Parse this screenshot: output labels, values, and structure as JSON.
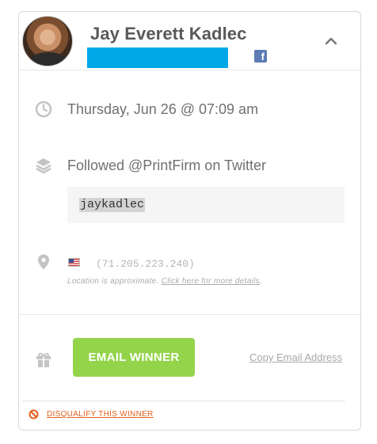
{
  "winner": {
    "name": "Jay Everett Kadlec"
  },
  "entry": {
    "datetime": "Thursday, Jun 26 @ 07:09 am",
    "action": "Followed @PrintFirm on Twitter",
    "handle": "jaykadlec"
  },
  "location": {
    "ip": "(71.205.223.240)",
    "note": "Location is approximate. ",
    "details_link": "Click here for more details",
    "note_end": "."
  },
  "actions": {
    "email_winner_label": "EMAIL WINNER",
    "copy_email_label": "Copy Email Address",
    "disqualify_label": "DISQUALIFY THIS WINNER"
  },
  "colors": {
    "email_redaction": "#00a8e8",
    "email_button": "#93d44b",
    "disqualify": "#e0601e",
    "facebook": "#5d7cb6"
  },
  "icons": {
    "avatar": "user-photo",
    "facebook": "facebook-icon",
    "collapse": "chevron-up-icon",
    "time": "clock-icon",
    "action": "layers-icon",
    "location": "map-pin-icon",
    "flag": "us-flag-icon",
    "prize": "gift-icon",
    "disqualify": "prohibited-icon"
  }
}
